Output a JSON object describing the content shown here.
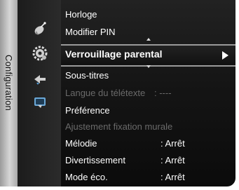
{
  "sidebar": {
    "title": "Configuration"
  },
  "icons": [
    "satellite-icon",
    "gear-icon",
    "input-icon",
    "tv-preview-icon"
  ],
  "menu": {
    "items": [
      {
        "label": "Horloge",
        "value": ""
      },
      {
        "label": "Modifier PIN",
        "value": ""
      },
      {
        "label": "Verrouillage parental",
        "value": "",
        "selected": true
      },
      {
        "label": "Sous-titres",
        "value": ""
      },
      {
        "label": "Langue du télétexte",
        "value": ": ----",
        "disabled": true
      },
      {
        "label": "Préférence",
        "value": ""
      },
      {
        "label": "Ajustement fixation murale",
        "value": "",
        "disabled": true
      },
      {
        "label": "Mélodie",
        "value": ": Arrêt"
      },
      {
        "label": "Divertissement",
        "value": ": Arrêt"
      },
      {
        "label": "Mode éco.",
        "value": ": Arrêt"
      }
    ]
  },
  "colors": {
    "background": "#111111",
    "sidebar": "#c8c8c8",
    "text": "#ffffff",
    "disabled_text": "#6a6a6a"
  }
}
